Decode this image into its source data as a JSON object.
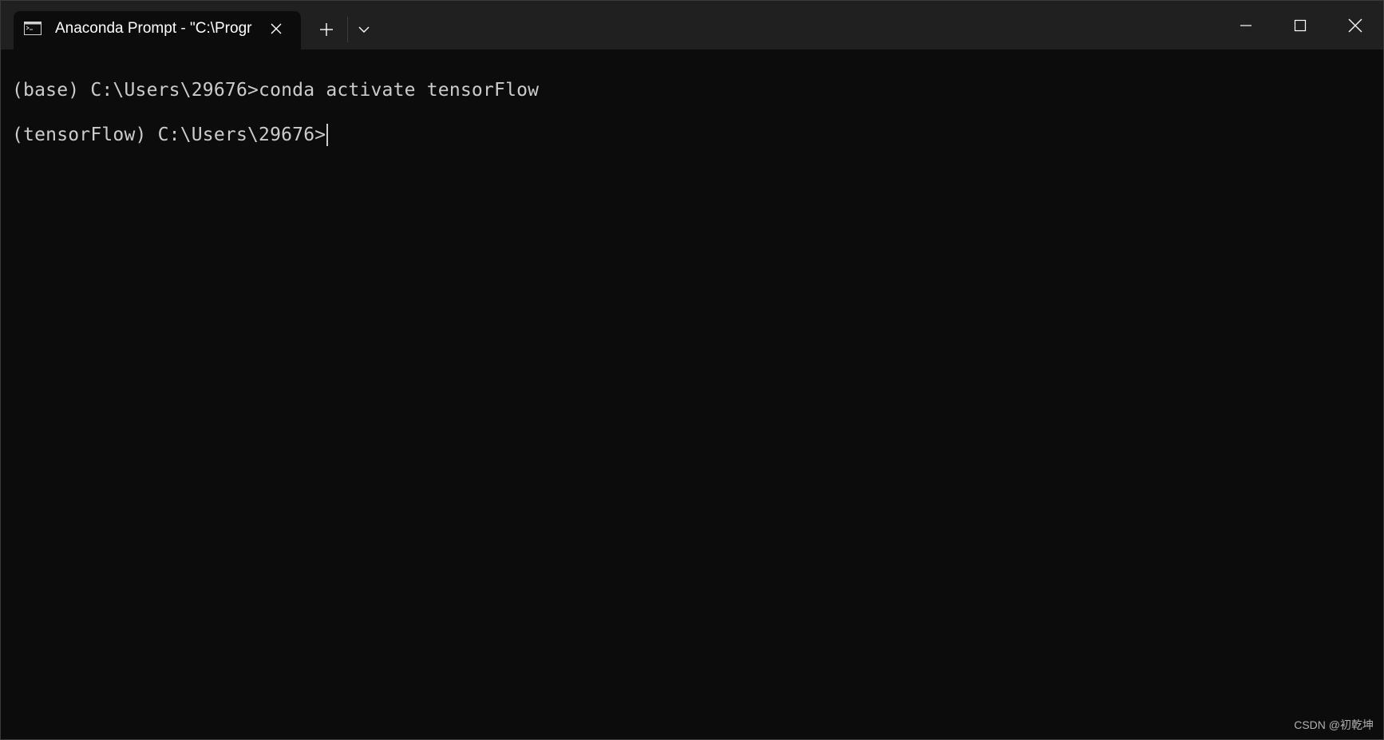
{
  "window": {
    "tab_title": "Anaconda Prompt - \"C:\\Progr",
    "tab_icon": "terminal-icon",
    "new_tab_icon": "plus-icon",
    "dropdown_icon": "chevron-down-icon",
    "minimize_icon": "minimize-icon",
    "maximize_icon": "maximize-icon",
    "close_icon": "close-icon"
  },
  "terminal": {
    "lines": [
      "(base) C:\\Users\\29676>conda activate tensorFlow",
      "(tensorFlow) C:\\Users\\29676>"
    ]
  },
  "watermark": "CSDN @初乾坤",
  "colors": {
    "background": "#0c0c0c",
    "titlebar": "#202020",
    "text": "#cccccc"
  }
}
